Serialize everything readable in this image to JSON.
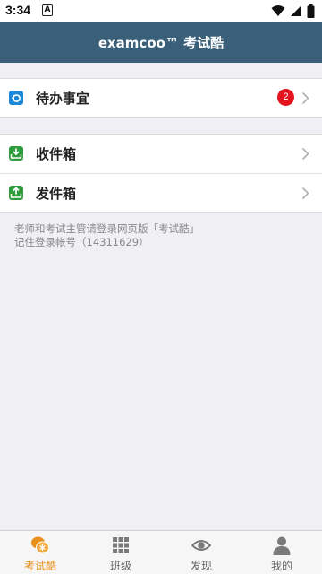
{
  "status_bar": {
    "time": "3:34",
    "notification_letter": "A"
  },
  "header": {
    "title": "examcoo™ 考试酷"
  },
  "todo": {
    "label": "待办事宜",
    "badge_count": "2"
  },
  "mail": {
    "inbox_label": "收件箱",
    "outbox_label": "发件箱"
  },
  "footnote": {
    "line1": "老师和考试主管请登录网页版「考试酷」",
    "line2": "记住登录帐号（14311629）"
  },
  "tabs": [
    {
      "label": "考试酷",
      "icon": "examcoo-icon"
    },
    {
      "label": "班级",
      "icon": "grid-icon"
    },
    {
      "label": "发现",
      "icon": "eye-icon"
    },
    {
      "label": "我的",
      "icon": "person-icon"
    }
  ],
  "colors": {
    "header": "#3a5f78",
    "badge": "#e3141e",
    "active_tab": "#e8901c",
    "background": "#efeff4"
  }
}
